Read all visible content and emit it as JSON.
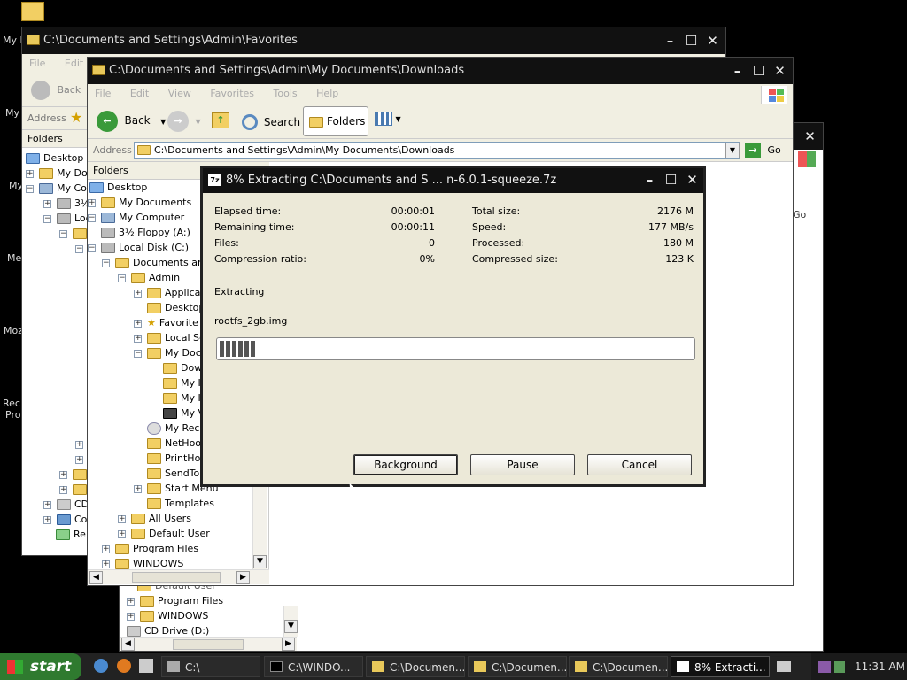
{
  "desktop": {
    "labels": [
      "My I",
      "My",
      "My",
      "Me",
      "Moz",
      "Rec",
      "Pro"
    ]
  },
  "win_favorites": {
    "title": "C:\\Documents and Settings\\Admin\\Favorites",
    "menu": [
      "File",
      "Edit"
    ],
    "back": "Back",
    "address_label": "Address",
    "folders_label": "Folders",
    "tree": [
      "Desktop",
      "My Doc",
      "My Co",
      "3½",
      "Loc",
      "My",
      "Me",
      "CD",
      "Co",
      "Re"
    ]
  },
  "win_downloads": {
    "title": "C:\\Documents and Settings\\Admin\\My Documents\\Downloads",
    "menu": [
      "File",
      "Edit",
      "View",
      "Favorites",
      "Tools",
      "Help"
    ],
    "toolbar": {
      "back": "Back",
      "search": "Search",
      "folders": "Folders"
    },
    "address_label": "Address",
    "address_value": "C:\\Documents and Settings\\Admin\\My Documents\\Downloads",
    "go": "Go",
    "folders_label": "Folders",
    "folders_close": "x",
    "tree": [
      "Desktop",
      "My Documents",
      "My Computer",
      "3½ Floppy (A:)",
      "Local Disk (C:)",
      "Documents and",
      "Admin",
      "Applicat",
      "Desktop",
      "Favorite",
      "Local Se",
      "My Docu",
      "Dow",
      "My I",
      "My I",
      "My V",
      "My Rece",
      "NetHoo",
      "PrintHoo",
      "SendTo",
      "Start Menu",
      "Templates",
      "All Users",
      "Default User",
      "Program Files",
      "WINDOWS"
    ]
  },
  "win_back": {
    "go": "Go",
    "tree": [
      "Default User",
      "Program Files",
      "WINDOWS",
      "CD Drive (D:)"
    ]
  },
  "dialog": {
    "title": "8% Extracting C:\\Documents and S ... n-6.0.1-squeeze.7z",
    "icon": "7z",
    "left_labels": [
      "Elapsed time:",
      "Remaining time:",
      "Files:",
      "Compression ratio:"
    ],
    "left_values": [
      "00:00:01",
      "00:00:11",
      "0",
      "0%"
    ],
    "right_labels": [
      "Total size:",
      "Speed:",
      "Processed:",
      "Compressed size:"
    ],
    "right_values": [
      "2176 M",
      "177 MB/s",
      "180 M",
      "123 K"
    ],
    "status": "Extracting",
    "file": "rootfs_2gb.img",
    "progress_fraction": 0.08,
    "buttons": {
      "background": "Background",
      "pause": "Pause",
      "cancel": "Cancel"
    }
  },
  "taskbar": {
    "start": "start",
    "tasks": [
      "C:\\",
      "C:\\WINDO...",
      "C:\\Documen...",
      "C:\\Documen...",
      "C:\\Documen...",
      "8% Extracti..."
    ],
    "clock": "11:31 AM"
  }
}
